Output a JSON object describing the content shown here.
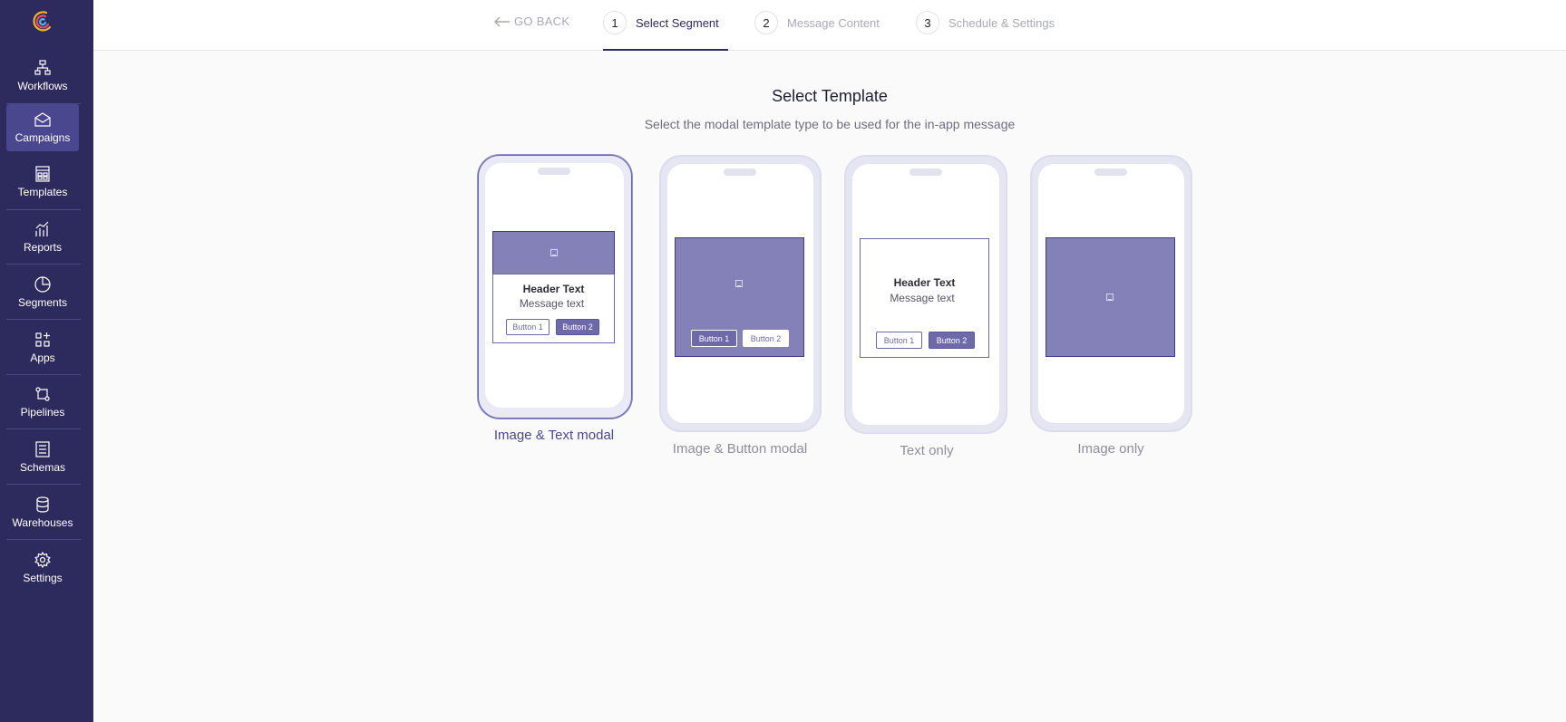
{
  "sidebar": {
    "items": [
      {
        "label": "Workflows",
        "icon": "workflows-icon"
      },
      {
        "label": "Campaigns",
        "icon": "campaigns-icon",
        "active": true
      },
      {
        "label": "Templates",
        "icon": "templates-icon"
      },
      {
        "label": "Reports",
        "icon": "reports-icon"
      },
      {
        "label": "Segments",
        "icon": "segments-icon"
      },
      {
        "label": "Apps",
        "icon": "apps-icon"
      },
      {
        "label": "Pipelines",
        "icon": "pipelines-icon"
      },
      {
        "label": "Schemas",
        "icon": "schemas-icon"
      },
      {
        "label": "Warehouses",
        "icon": "warehouses-icon"
      },
      {
        "label": "Settings",
        "icon": "settings-icon"
      }
    ]
  },
  "topbar": {
    "go_back": "GO BACK",
    "steps": [
      {
        "num": "1",
        "label": "Select Segment",
        "active": true
      },
      {
        "num": "2",
        "label": "Message Content"
      },
      {
        "num": "3",
        "label": "Schedule & Settings"
      }
    ]
  },
  "main": {
    "title": "Select Template",
    "subtitle": "Select the modal template type to be used for the in-app message"
  },
  "templates": [
    {
      "label": "Image & Text modal",
      "selected": true,
      "header": "Header Text",
      "message": "Message text",
      "button1": "Button 1",
      "button2": "Button 2"
    },
    {
      "label": "Image & Button modal",
      "button1": "Button 1",
      "button2": "Button 2"
    },
    {
      "label": "Text only",
      "header": "Header Text",
      "message": "Message text",
      "button1": "Button 1",
      "button2": "Button 2"
    },
    {
      "label": "Image only"
    }
  ],
  "colors": {
    "sidebar_bg": "#2d2a5e",
    "accent": "#4a478f",
    "modal_fill": "#8480b8"
  }
}
